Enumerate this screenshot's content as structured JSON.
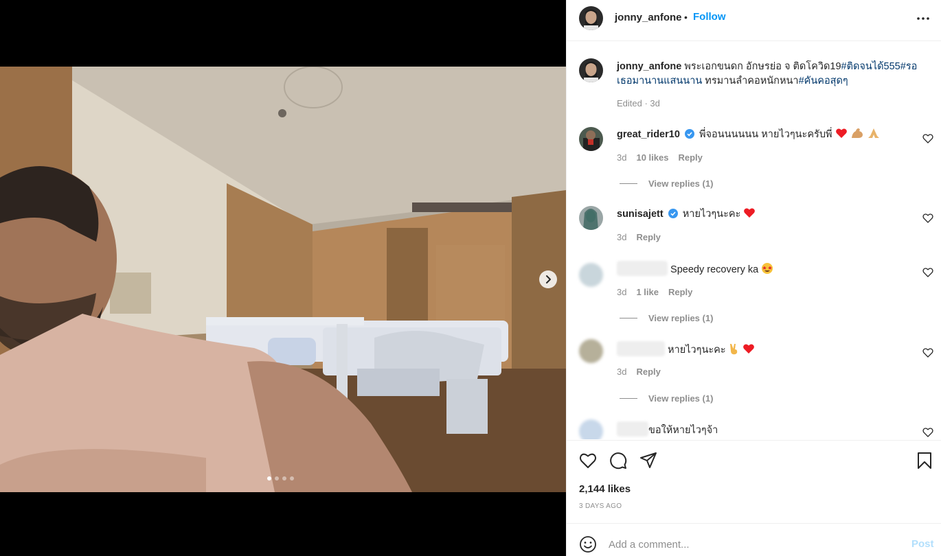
{
  "post": {
    "username": "jonny_anfone",
    "follow_label": "Follow",
    "separator": "•",
    "caption_parts": [
      {
        "text": " พระเอกขนดก อักษรย่อ จ ติดโควิด19",
        "tag": false
      },
      {
        "text": "#ติดจนได้555",
        "tag": true
      },
      {
        "text": "#รอเธอมานานแสนนาน",
        "tag": true
      },
      {
        "text": " ทรมานลำคอหนักหนา",
        "tag": false
      },
      {
        "text": "#คันคอสุดๆ",
        "tag": true
      }
    ],
    "caption_meta": "Edited · 3d",
    "carousel": {
      "count": 4,
      "active_index": 0
    }
  },
  "comments": [
    {
      "username": "great_rider10",
      "verified": true,
      "text": "พี่จอนนนนนน หายไวๆนะครับพี่",
      "emojis": [
        "heart-emoji",
        "flexed-biceps-emoji",
        "folded-hands-emoji"
      ],
      "age": "3d",
      "likes": "10 likes",
      "reply": "Reply",
      "view_replies": "View replies (1)"
    },
    {
      "username": "sunisajett",
      "verified": true,
      "text": "หายไวๆนะคะ",
      "emojis": [
        "heart-emoji"
      ],
      "age": "3d",
      "likes": "",
      "reply": "Reply",
      "view_replies": ""
    },
    {
      "username": "",
      "verified": false,
      "text": "Speedy recovery ka",
      "emojis": [
        "star-struck-emoji"
      ],
      "age": "3d",
      "likes": "1 like",
      "reply": "Reply",
      "view_replies": "View replies (1)"
    },
    {
      "username": "",
      "verified": false,
      "text": "หายไวๆนะคะ",
      "emojis": [
        "victory-hand-emoji",
        "heart-emoji"
      ],
      "age": "3d",
      "likes": "",
      "reply": "Reply",
      "view_replies": "View replies (1)"
    },
    {
      "username": "",
      "verified": false,
      "text": "ขอให้หายไวๆจ้า",
      "emojis": [],
      "age": "",
      "likes": "",
      "reply": "",
      "view_replies": ""
    }
  ],
  "actions": {
    "icons": [
      "heart-icon",
      "comment-icon",
      "share-icon",
      "bookmark-icon"
    ],
    "likes": "2,144 likes",
    "posted": "3 DAYS AGO"
  },
  "add_comment": {
    "placeholder": "Add a comment...",
    "post_label": "Post"
  },
  "colors": {
    "link_blue": "#0095f6",
    "hashtag": "#00376b",
    "muted": "#8e8e8e",
    "heart_red": "#ed1c24"
  }
}
